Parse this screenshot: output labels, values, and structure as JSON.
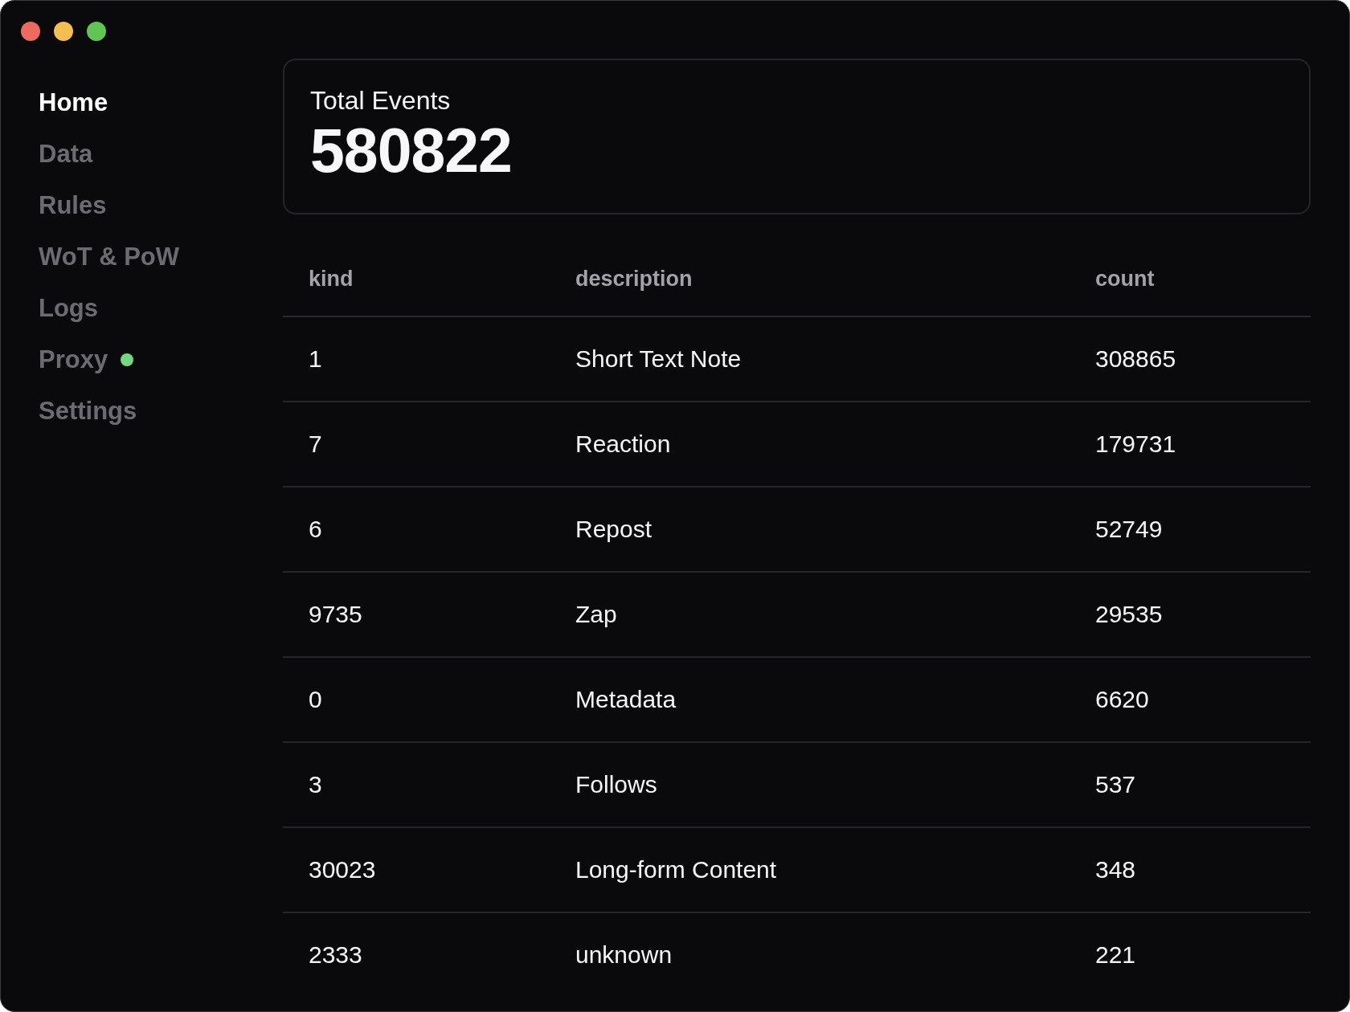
{
  "window": {
    "controls": [
      {
        "kind": "close"
      },
      {
        "kind": "minimize"
      },
      {
        "kind": "maximize"
      }
    ]
  },
  "sidebar": {
    "items": [
      {
        "label": "Home",
        "selected": true,
        "dot": false
      },
      {
        "label": "Data",
        "selected": false,
        "dot": false
      },
      {
        "label": "Rules",
        "selected": false,
        "dot": false
      },
      {
        "label": "WoT & PoW",
        "selected": false,
        "dot": false
      },
      {
        "label": "Logs",
        "selected": false,
        "dot": false
      },
      {
        "label": "Proxy",
        "selected": false,
        "dot": true
      },
      {
        "label": "Settings",
        "selected": false,
        "dot": false
      }
    ]
  },
  "summary": {
    "label": "Total Events",
    "value": "580822"
  },
  "table": {
    "columns": [
      "kind",
      "description",
      "count"
    ],
    "rows": [
      [
        "1",
        "Short Text Note",
        "308865"
      ],
      [
        "7",
        "Reaction",
        "179731"
      ],
      [
        "6",
        "Repost",
        "52749"
      ],
      [
        "9735",
        "Zap",
        "29535"
      ],
      [
        "0",
        "Metadata",
        "6620"
      ],
      [
        "3",
        "Follows",
        "537"
      ],
      [
        "30023",
        "Long-form Content",
        "348"
      ],
      [
        "2333",
        "unknown",
        "221"
      ]
    ]
  }
}
